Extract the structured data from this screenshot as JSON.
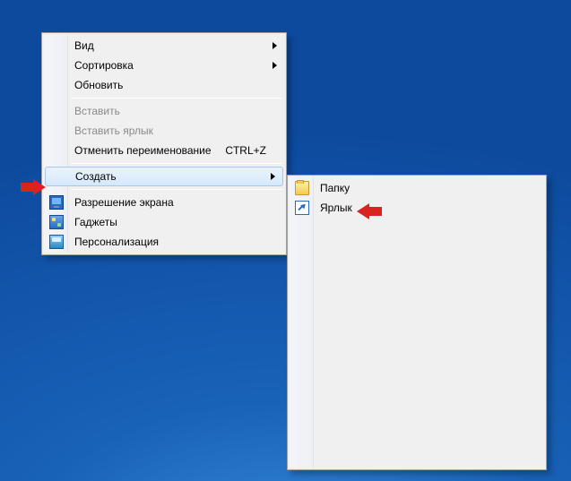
{
  "mainMenu": {
    "view": {
      "label": "Вид",
      "submenu": true
    },
    "sort": {
      "label": "Сортировка",
      "submenu": true
    },
    "refresh": {
      "label": "Обновить"
    },
    "paste": {
      "label": "Вставить",
      "disabled": true
    },
    "pasteLink": {
      "label": "Вставить ярлык",
      "disabled": true
    },
    "undo": {
      "label": "Отменить переименование",
      "shortcut": "CTRL+Z"
    },
    "create": {
      "label": "Создать",
      "submenu": true,
      "highlighted": true
    },
    "resolution": {
      "label": "Разрешение экрана",
      "icon": "screen"
    },
    "gadgets": {
      "label": "Гаджеты",
      "icon": "gadget"
    },
    "personalize": {
      "label": "Персонализация",
      "icon": "personal"
    }
  },
  "subMenu": {
    "folder": {
      "label": "Папку",
      "icon": "folder"
    },
    "shortcut": {
      "label": "Ярлык",
      "icon": "shortcut"
    }
  }
}
